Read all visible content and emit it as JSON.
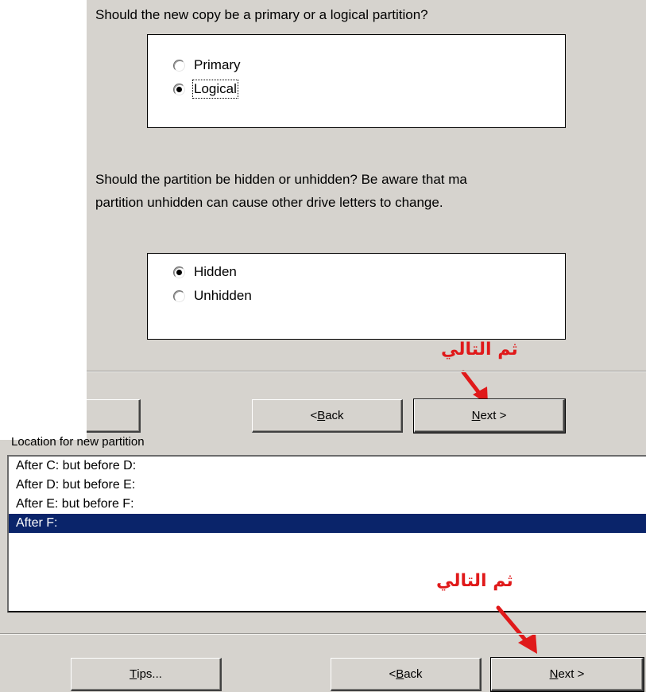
{
  "partition_type": {
    "question": "Should the new copy be a primary or a logical partition?",
    "options": [
      {
        "label": "Primary",
        "checked": false
      },
      {
        "label": "Logical",
        "checked": true
      }
    ]
  },
  "visibility": {
    "question_line1": "Should the partition be hidden or unhidden?  Be aware that ma",
    "question_line2": "partition unhidden can cause other drive letters to change.",
    "options": [
      {
        "label": "Hidden",
        "checked": true
      },
      {
        "label": "Unhidden",
        "checked": false
      }
    ]
  },
  "annotation": {
    "text": "ثم التالي",
    "color": "#e0191a"
  },
  "top_buttons": {
    "back_prefix": "< ",
    "back_mnemonic": "B",
    "back_rest": "ack",
    "next_mnemonic": "N",
    "next_rest": "ext >"
  },
  "location": {
    "label": "Location for new partition",
    "items": [
      {
        "label": "After C:  but before D:",
        "selected": false
      },
      {
        "label": "After D:  but before E:",
        "selected": false
      },
      {
        "label": "After E:  but before F:",
        "selected": false
      },
      {
        "label": "After F:",
        "selected": true
      }
    ]
  },
  "bottom_buttons": {
    "tips_mnemonic": "T",
    "tips_rest": "ips...",
    "back_prefix": "< ",
    "back_mnemonic": "B",
    "back_rest": "ack",
    "next_mnemonic": "N",
    "next_rest": "ext >"
  },
  "colors": {
    "dialog_bg": "#d6d3ce",
    "selection_bg": "#0a246a",
    "annotation": "#e0191a"
  }
}
